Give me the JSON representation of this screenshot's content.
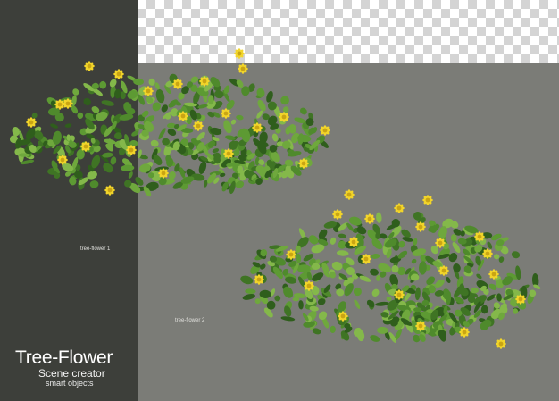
{
  "captions": {
    "first": "tree-flower 1",
    "second": "tree-flower 2"
  },
  "brand": {
    "title": "Tree-Flower",
    "subtitle": "Scene creator",
    "tagline": "smart objects"
  },
  "colors": {
    "left_panel": "#3d3f3a",
    "gray_panel": "#7b7c77",
    "leaf": "#4f8a2c",
    "leaf_light": "#7fae45",
    "flower": "#f2d52a"
  }
}
